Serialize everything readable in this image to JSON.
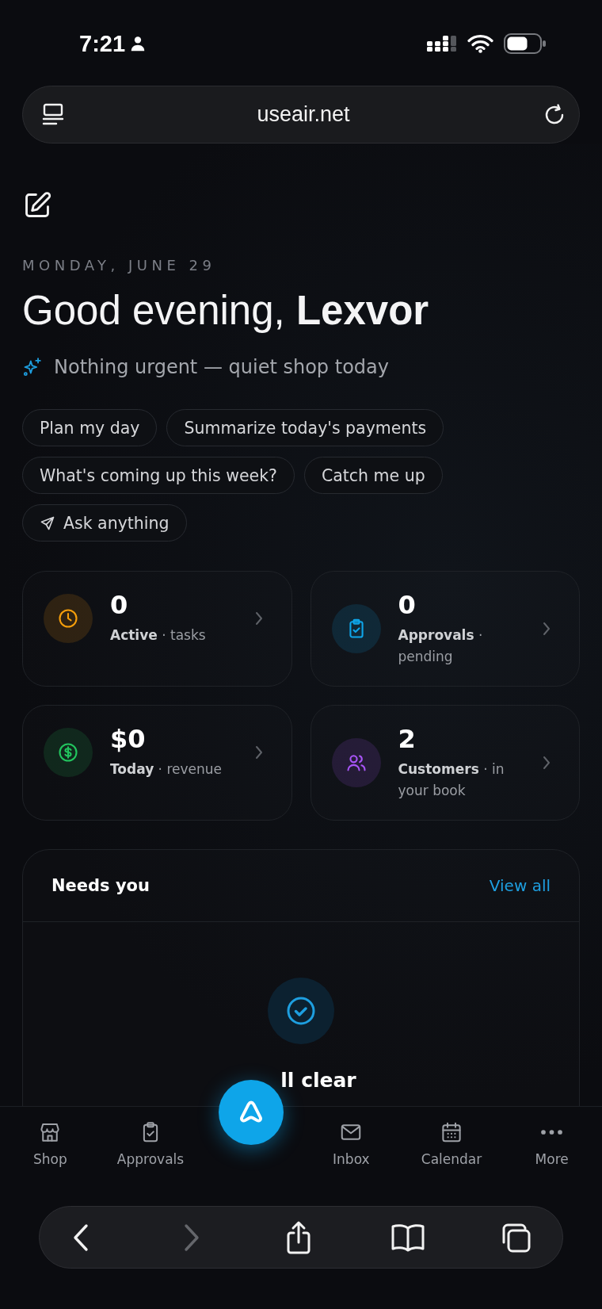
{
  "status_bar": {
    "time": "7:21"
  },
  "address_bar": {
    "url": "useair.net"
  },
  "header": {
    "date": "MONDAY, JUNE 29",
    "greeting": "Good evening, **Lexvor**",
    "summary": "Nothing urgent — quiet shop today"
  },
  "suggestions": [
    {
      "kind": "prompt",
      "label": "Plan my day"
    },
    {
      "kind": "prompt",
      "label": "Summarize today's payments"
    },
    {
      "kind": "prompt",
      "label": "What's coming up this week?"
    },
    {
      "kind": "prompt",
      "label": "Catch me up"
    },
    {
      "kind": "ask",
      "label": "Ask anything"
    }
  ],
  "stats": [
    {
      "value": "0",
      "label": "**Active** · tasks",
      "color": "#f59e0b"
    },
    {
      "value": "0",
      "label": "**Approvals** · pending",
      "color": "#0ea5e9"
    },
    {
      "value": "$0",
      "label": "**Today** · revenue",
      "color": "#22c55e"
    },
    {
      "value": "2",
      "label": "**Customers** · in your book",
      "color": "#a855f7"
    }
  ],
  "needs_you": {
    "title": "Needs you",
    "link": "View all",
    "empty_title": "ll clear"
  },
  "bottom_nav": [
    {
      "label": "Shop",
      "selected": false
    },
    {
      "label": "Approvals",
      "selected": false
    },
    {
      "label": "Inbox",
      "selected": false
    },
    {
      "label": "Calendar",
      "selected": false
    },
    {
      "label": "More",
      "selected": false
    }
  ],
  "browser_toolbar": {
    "navigation": [
      {
        "disabled": false
      },
      {
        "disabled": true
      }
    ]
  }
}
